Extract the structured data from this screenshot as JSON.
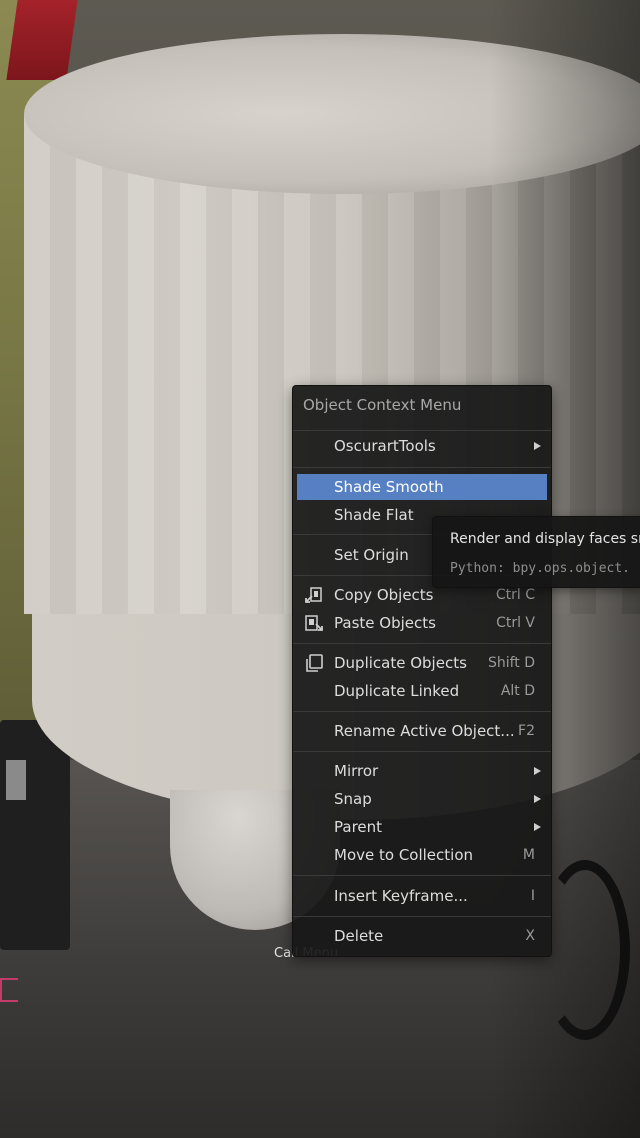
{
  "menu": {
    "title": "Object Context Menu",
    "items": [
      {
        "label": "OscurartTools",
        "shortcut": "",
        "submenu": true
      },
      {
        "label": "Shade Smooth",
        "shortcut": "",
        "highlighted": true
      },
      {
        "label": "Shade Flat",
        "shortcut": ""
      },
      {
        "label": "Set Origin",
        "shortcut": "",
        "submenu": true
      },
      {
        "label": "Copy Objects",
        "shortcut": "Ctrl C",
        "icon": "copy-icon"
      },
      {
        "label": "Paste Objects",
        "shortcut": "Ctrl V",
        "icon": "paste-icon"
      },
      {
        "label": "Duplicate Objects",
        "shortcut": "Shift D",
        "icon": "duplicate-icon"
      },
      {
        "label": "Duplicate Linked",
        "shortcut": "Alt D"
      },
      {
        "label": "Rename Active Object...",
        "shortcut": "F2"
      },
      {
        "label": "Mirror",
        "shortcut": "",
        "submenu": true
      },
      {
        "label": "Snap",
        "shortcut": "",
        "submenu": true
      },
      {
        "label": "Parent",
        "shortcut": "",
        "submenu": true
      },
      {
        "label": "Move to Collection",
        "shortcut": "M"
      },
      {
        "label": "Insert Keyframe...",
        "shortcut": "I"
      },
      {
        "label": "Delete",
        "shortcut": "X"
      }
    ]
  },
  "tooltip": {
    "description": "Render and display faces sn",
    "python": "Python: bpy.ops.object."
  },
  "background": {
    "partial_label": "Call Menu"
  },
  "colors": {
    "highlight": "#5680c2",
    "menu_bg": "#181818"
  }
}
